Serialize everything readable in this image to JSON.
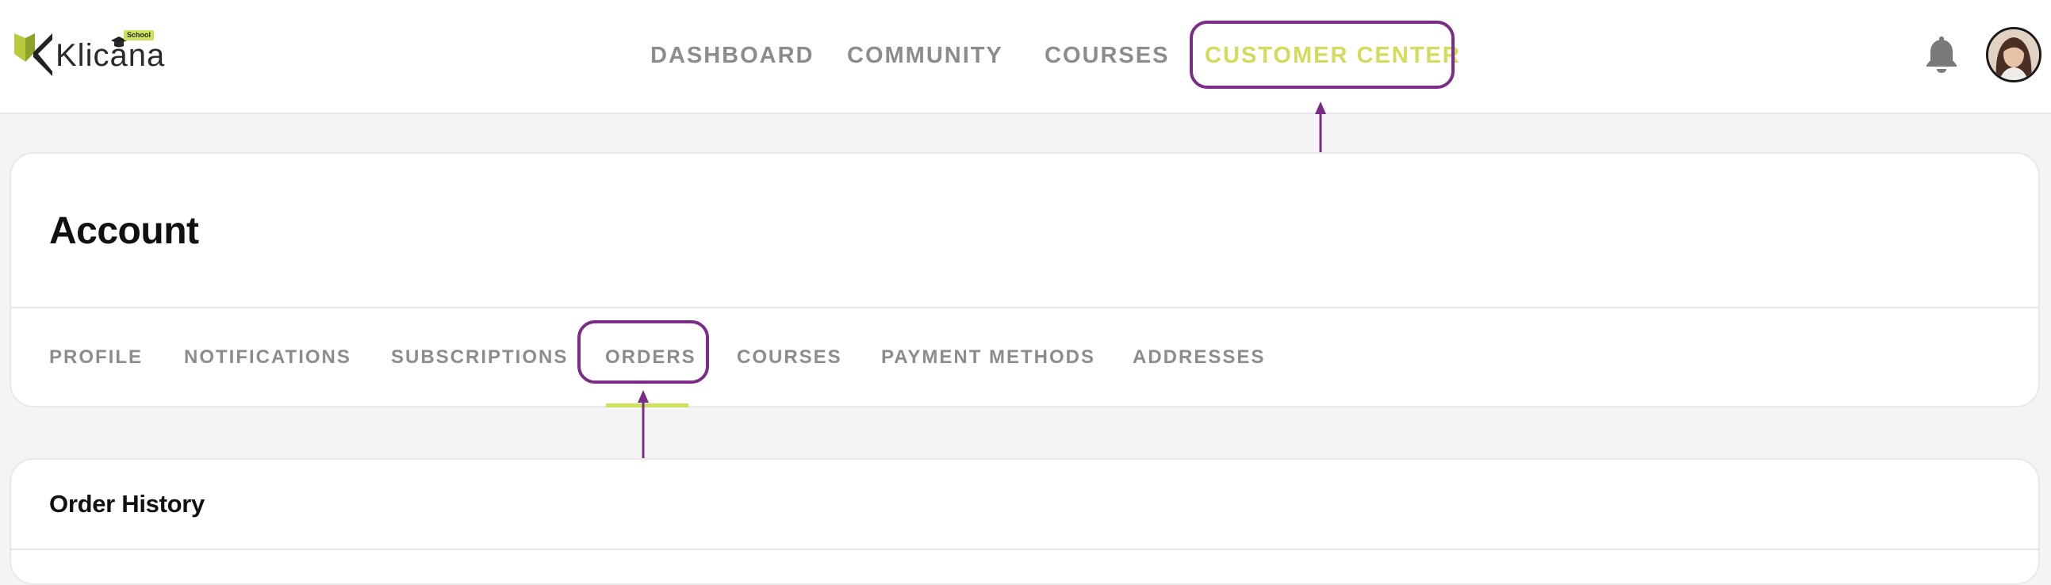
{
  "brand": {
    "name": "Klicana",
    "badge": "School",
    "accent_color": "#cfe05a",
    "highlight_color": "#7b2c86"
  },
  "nav": {
    "items": [
      {
        "label": "DASHBOARD"
      },
      {
        "label": "COMMUNITY"
      },
      {
        "label": "COURSES"
      },
      {
        "label": "CUSTOMER CENTER",
        "active": true
      }
    ]
  },
  "header_icons": {
    "notifications": "bell-icon",
    "profile": "avatar"
  },
  "account": {
    "title": "Account",
    "tabs": [
      {
        "label": "PROFILE"
      },
      {
        "label": "NOTIFICATIONS"
      },
      {
        "label": "SUBSCRIPTIONS"
      },
      {
        "label": "ORDERS",
        "active": true
      },
      {
        "label": "COURSES"
      },
      {
        "label": "PAYMENT METHODS"
      },
      {
        "label": "ADDRESSES"
      }
    ]
  },
  "order_history": {
    "title": "Order History"
  }
}
